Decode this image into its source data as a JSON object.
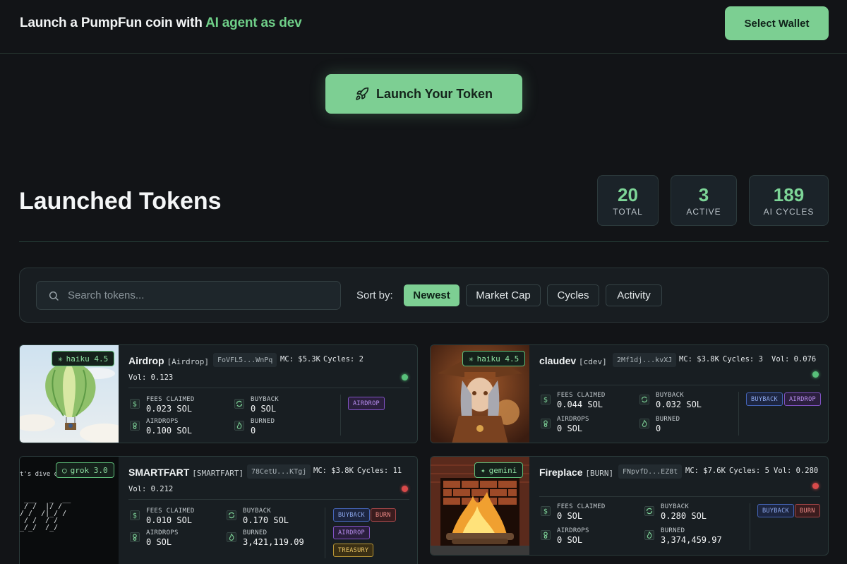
{
  "header": {
    "brand_prefix": "Launch a PumpFun coin with ",
    "brand_accent": "AI agent as dev",
    "wallet_button": "Select Wallet"
  },
  "launch_button": "Launch Your Token",
  "section": {
    "title": "Launched Tokens",
    "stats": [
      {
        "value": "20",
        "label": "TOTAL"
      },
      {
        "value": "3",
        "label": "ACTIVE"
      },
      {
        "value": "189",
        "label": "AI CYCLES"
      }
    ]
  },
  "filters": {
    "search_placeholder": "Search tokens...",
    "sort_label": "Sort by:",
    "sort_options": [
      "Newest",
      "Market Cap",
      "Cycles",
      "Activity"
    ],
    "active_sort": "Newest"
  },
  "labels": {
    "fees": "FEES CLAIMED",
    "buyback": "BUYBACK",
    "airdrops": "AIRDROPS",
    "burned": "BURNED"
  },
  "tokens": [
    {
      "model": "haiku 4.5",
      "name": "Airdrop",
      "symbol": "[Airdrop]",
      "address": "FoVFL5...WnPq",
      "mc": "MC: $5.3K",
      "cycles": "Cycles: 2",
      "vol": "Vol: 0.123",
      "active": true,
      "fees": "0.023 SOL",
      "buyback": "0 SOL",
      "airdrops": "0.100 SOL",
      "burned": "0",
      "tags": [
        "AIRDROP"
      ]
    },
    {
      "model": "haiku 4.5",
      "name": "claudev",
      "symbol": "[cdev]",
      "address": "2Mf1dj...kvXJ",
      "mc": "MC: $3.8K",
      "cycles": "Cycles: 3",
      "vol": "Vol: 0.076",
      "active": true,
      "fees": "0.044 SOL",
      "buyback": "0.032 SOL",
      "airdrops": "0 SOL",
      "burned": "0",
      "tags": [
        "BUYBACK",
        "AIRDROP"
      ]
    },
    {
      "model": "grok 3.0",
      "name": "SMARTFART",
      "symbol": "[SMARTFART]",
      "address": "78CetU...KTgj",
      "mc": "MC: $3.8K",
      "cycles": "Cycles: 11",
      "vol": "Vol: 0.212",
      "active": false,
      "fees": "0.010 SOL",
      "buyback": "0.170 SOL",
      "airdrops": "0 SOL",
      "burned": "3,421,119.09",
      "tags": [
        "BUYBACK",
        "BURN",
        "AIRDROP",
        "TREASURY"
      ],
      "thumb_text": "t's dive d"
    },
    {
      "model": "gemini",
      "name": "Fireplace",
      "symbol": "[BURN]",
      "address": "FNpvfD...EZ8t",
      "mc": "MC: $7.6K",
      "cycles": "Cycles: 5",
      "vol": "Vol: 0.280",
      "active": false,
      "fees": "0 SOL",
      "buyback": "0.280 SOL",
      "airdrops": "0 SOL",
      "burned": "3,374,459.97",
      "tags": [
        "BUYBACK",
        "BURN"
      ]
    }
  ],
  "colors": {
    "accent": "#7dcf93",
    "background": "#121417",
    "card": "#181e22",
    "active_dot": "#58c07a",
    "inactive_dot": "#d84a4a"
  }
}
